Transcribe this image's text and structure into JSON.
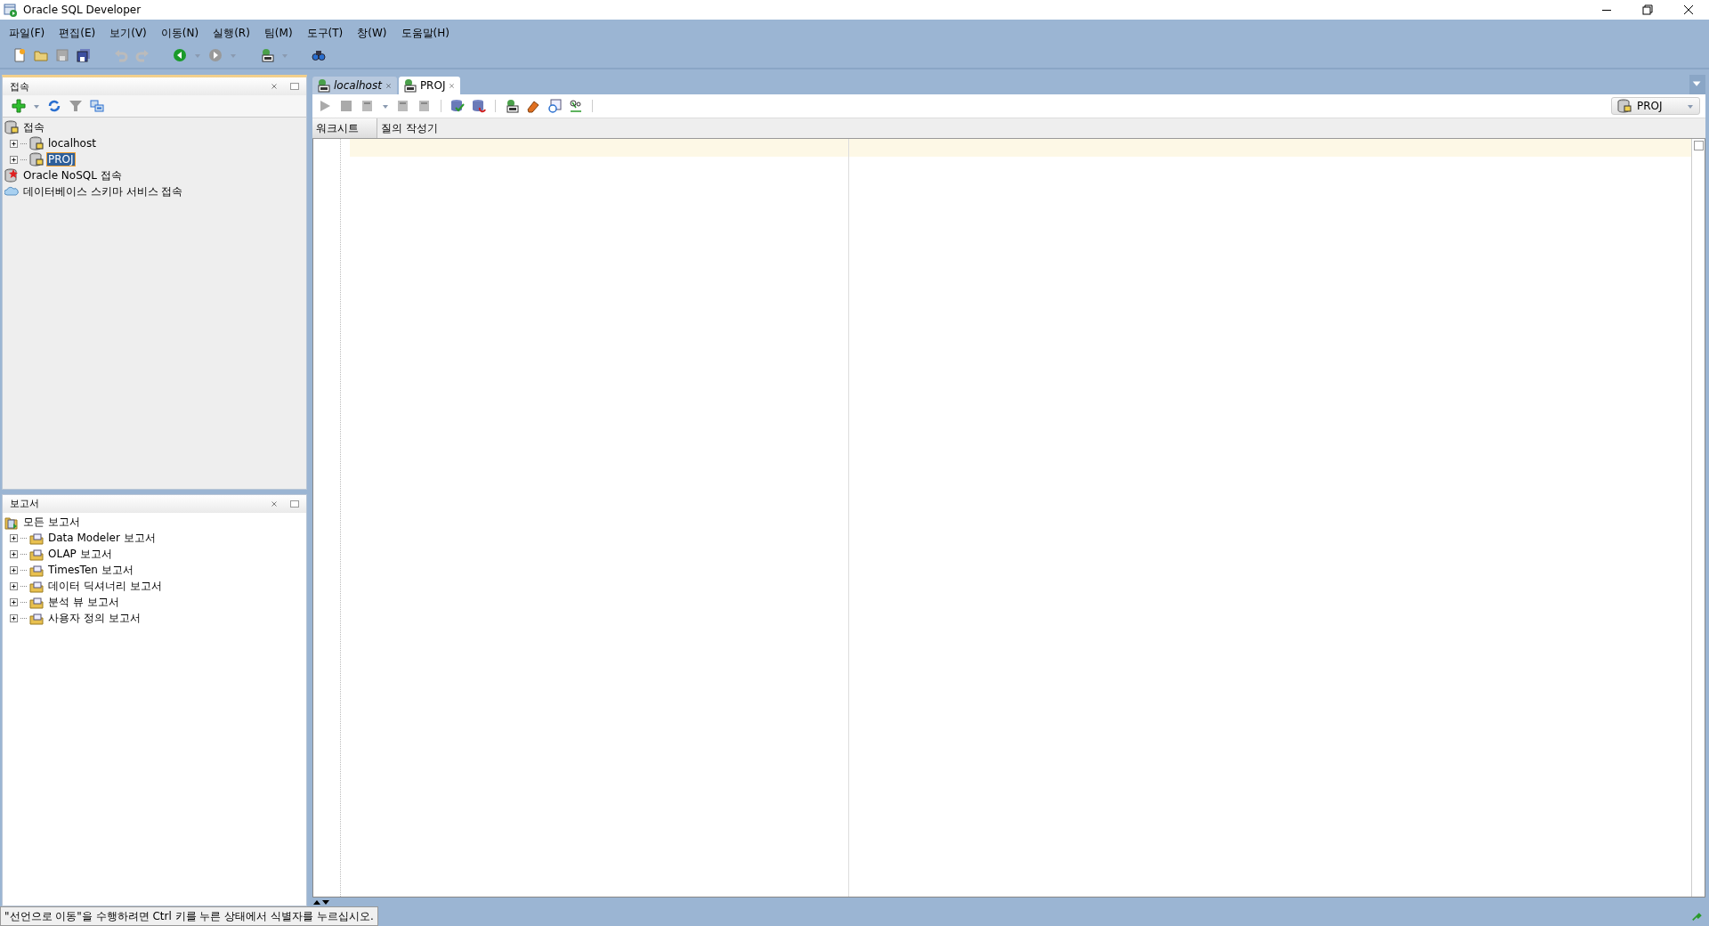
{
  "window": {
    "title": "Oracle SQL Developer"
  },
  "menu": [
    "파일(F)",
    "편집(E)",
    "보기(V)",
    "이동(N)",
    "실행(R)",
    "팀(M)",
    "도구(T)",
    "창(W)",
    "도움말(H)"
  ],
  "connections_panel": {
    "title": "접속",
    "tree": [
      {
        "label": "접속",
        "kind": "connections-root",
        "children": [
          {
            "label": "localhost",
            "kind": "db",
            "expanded": false,
            "selected": false
          },
          {
            "label": "PROJ",
            "kind": "db",
            "expanded": false,
            "selected": true
          }
        ]
      },
      {
        "label": "Oracle NoSQL 접속",
        "kind": "nosql"
      },
      {
        "label": "데이터베이스 스키마 서비스 접속",
        "kind": "cloud"
      }
    ]
  },
  "reports_panel": {
    "title": "보고서",
    "tree": [
      {
        "label": "모든 보고서",
        "kind": "reports-root",
        "children": [
          {
            "label": "Data Modeler 보고서",
            "kind": "folder",
            "expanded": false
          },
          {
            "label": "OLAP 보고서",
            "kind": "folder",
            "expanded": false
          },
          {
            "label": "TimesTen 보고서",
            "kind": "folder",
            "expanded": false
          },
          {
            "label": "데이터 딕셔너리 보고서",
            "kind": "folder",
            "expanded": false
          },
          {
            "label": "분석 뷰 보고서",
            "kind": "folder",
            "expanded": false
          },
          {
            "label": "사용자 정의 보고서",
            "kind": "folder",
            "expanded": false
          }
        ]
      }
    ]
  },
  "editor_tabs": [
    {
      "label": "localhost",
      "selected": false
    },
    {
      "label": "PROJ",
      "selected": true
    }
  ],
  "connection_selector": {
    "value": "PROJ"
  },
  "worksheet_tabs": [
    {
      "label": "워크시트",
      "selected": true
    },
    {
      "label": "질의 작성기",
      "selected": false
    }
  ],
  "status_bar": {
    "message": "\"선언으로 이동\"을 수행하려면 Ctrl 키를 누른 상태에서 식별자를 누르십시오."
  }
}
